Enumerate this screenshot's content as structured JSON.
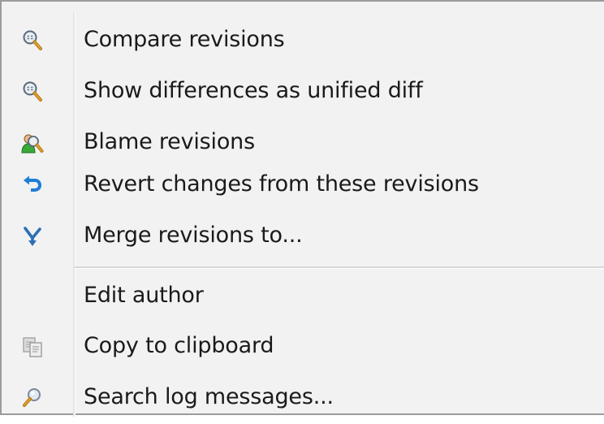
{
  "menu": {
    "items": [
      {
        "label": "Compare revisions",
        "icon": "magnifier-icon"
      },
      {
        "label": "Show differences as unified diff",
        "icon": "magnifier-icon"
      },
      {
        "label": "Blame revisions",
        "icon": "blame-user-magnifier-icon"
      },
      {
        "label": "Revert changes from these revisions",
        "icon": "revert-arrow-icon"
      },
      {
        "label": "Merge revisions to...",
        "icon": "merge-icon"
      },
      {
        "label": "Edit author",
        "icon": ""
      },
      {
        "label": "Copy to clipboard",
        "icon": "clipboard-copy-icon"
      },
      {
        "label": "Search log messages...",
        "icon": "search-magnifier-icon"
      }
    ]
  },
  "colors": {
    "menu_background": "#f2f2f2",
    "border": "#9b9b9b",
    "text": "#1a1a1a",
    "revert_blue": "#1f7fd6",
    "merge_blue": "#2d6fb5"
  }
}
